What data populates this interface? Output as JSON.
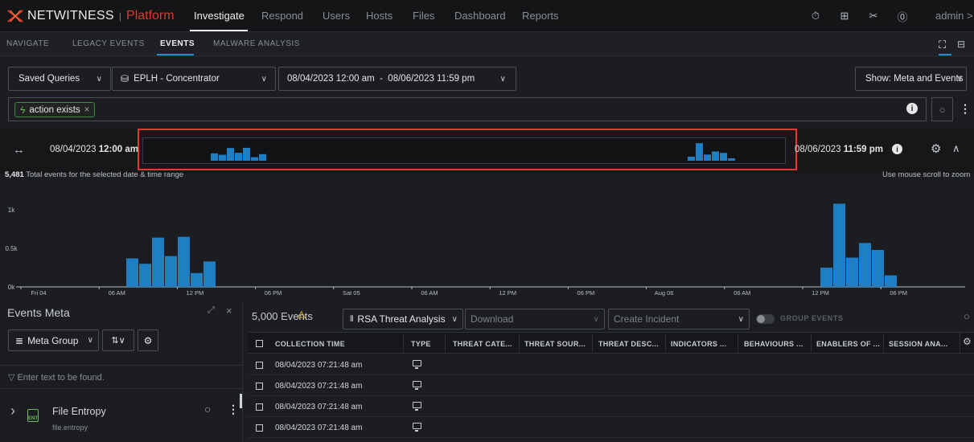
{
  "topnav": {
    "brand": "NETWITNESS",
    "brand_sep": "|",
    "platform": "Platform",
    "items": [
      {
        "label": "Investigate",
        "active": true
      },
      {
        "label": "Respond"
      },
      {
        "label": "Users"
      },
      {
        "label": "Hosts"
      },
      {
        "label": "Files"
      },
      {
        "label": "Dashboard"
      },
      {
        "label": "Reports"
      }
    ],
    "user": "admin >"
  },
  "subnav": {
    "items": [
      {
        "label": "NAVIGATE"
      },
      {
        "label": "LEGACY EVENTS"
      },
      {
        "label": "EVENTS",
        "active": true
      },
      {
        "label": "MALWARE ANALYSIS"
      }
    ]
  },
  "query": {
    "saved_queries": "Saved Queries",
    "service": "EPLH - Concentrator",
    "date_range": "08/04/2023 12:00 am  -  08/06/2023 11:59 pm",
    "show": "Show: Meta and Events",
    "filter_pill": "action exists",
    "filter_pill_close": "×"
  },
  "timeline": {
    "start_date": "08/04/2023",
    "start_time": "12:00 am",
    "end_date": "08/06/2023",
    "end_time": "11:59 pm",
    "total_events": "5,481 Total events for the selected date & time range",
    "scroll_hint": "Use mouse scroll to zoom"
  },
  "chart_data": {
    "type": "bar",
    "yticks": [
      "1k",
      "0.5k",
      "0k"
    ],
    "ylim": [
      0,
      1200
    ],
    "xtick_labels": [
      "Fri 04",
      "06 AM",
      "12 PM",
      "06 PM",
      "Sat 05",
      "06 AM",
      "12 PM",
      "06 PM",
      "Aug 06",
      "06 AM",
      "12 PM",
      "06 PM"
    ],
    "series": [
      {
        "values_cluster1": [
          370,
          300,
          640,
          400,
          650,
          180,
          330
        ]
      },
      {
        "values_cluster2": [
          250,
          1080,
          380,
          570,
          480,
          150
        ]
      }
    ],
    "color": "#1f7fc4"
  },
  "meta_panel": {
    "title": "Events Meta",
    "meta_group": "Meta Group",
    "search_placeholder": "Enter text to be found.",
    "item_name": "File Entropy",
    "item_key": "file.entropy",
    "item_icon_text": "ENT"
  },
  "events": {
    "count": "5,000 Events",
    "profile": "RSA Threat Analysis",
    "download": "Download",
    "create_incident": "Create Incident",
    "group_events": "GROUP EVENTS",
    "columns": [
      "COLLECTION TIME",
      "TYPE",
      "THREAT CATE...",
      "THREAT SOUR...",
      "THREAT DESC...",
      "INDICATORS ...",
      "BEHAVIOURS ...",
      "ENABLERS OF ...",
      "SESSION ANA..."
    ],
    "rows": [
      {
        "time": "08/04/2023 07:21:48 am"
      },
      {
        "time": "08/04/2023 07:21:48 am"
      },
      {
        "time": "08/04/2023 07:21:48 am"
      },
      {
        "time": "08/04/2023 07:21:48 am"
      }
    ]
  }
}
